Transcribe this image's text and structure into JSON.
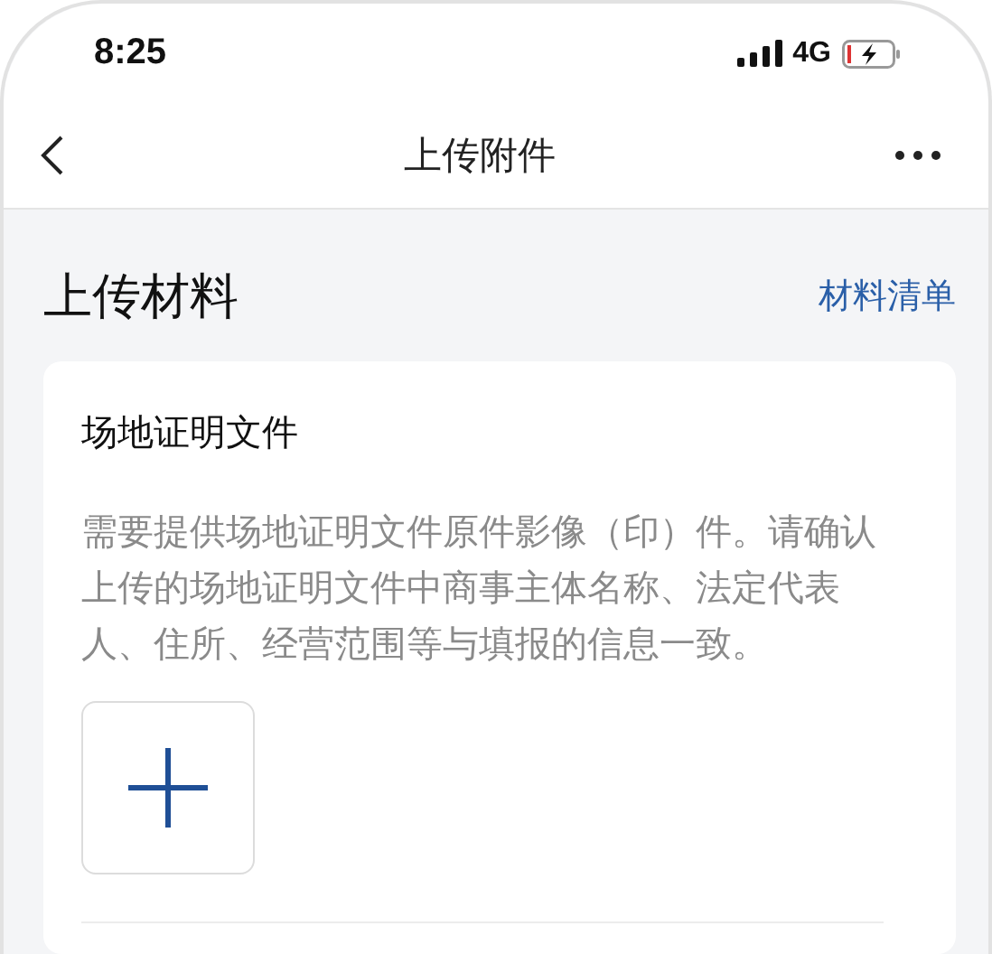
{
  "status_bar": {
    "time": "8:25",
    "network": "4G"
  },
  "nav_bar": {
    "title": "上传附件"
  },
  "section": {
    "title": "上传材料",
    "link": "材料清单"
  },
  "card": {
    "title": "场地证明文件",
    "description": "需要提供场地证明文件原件影像（印）件。请确认上传的场地证明文件中商事主体名称、法定代表人、住所、经营范围等与填报的信息一致。"
  }
}
